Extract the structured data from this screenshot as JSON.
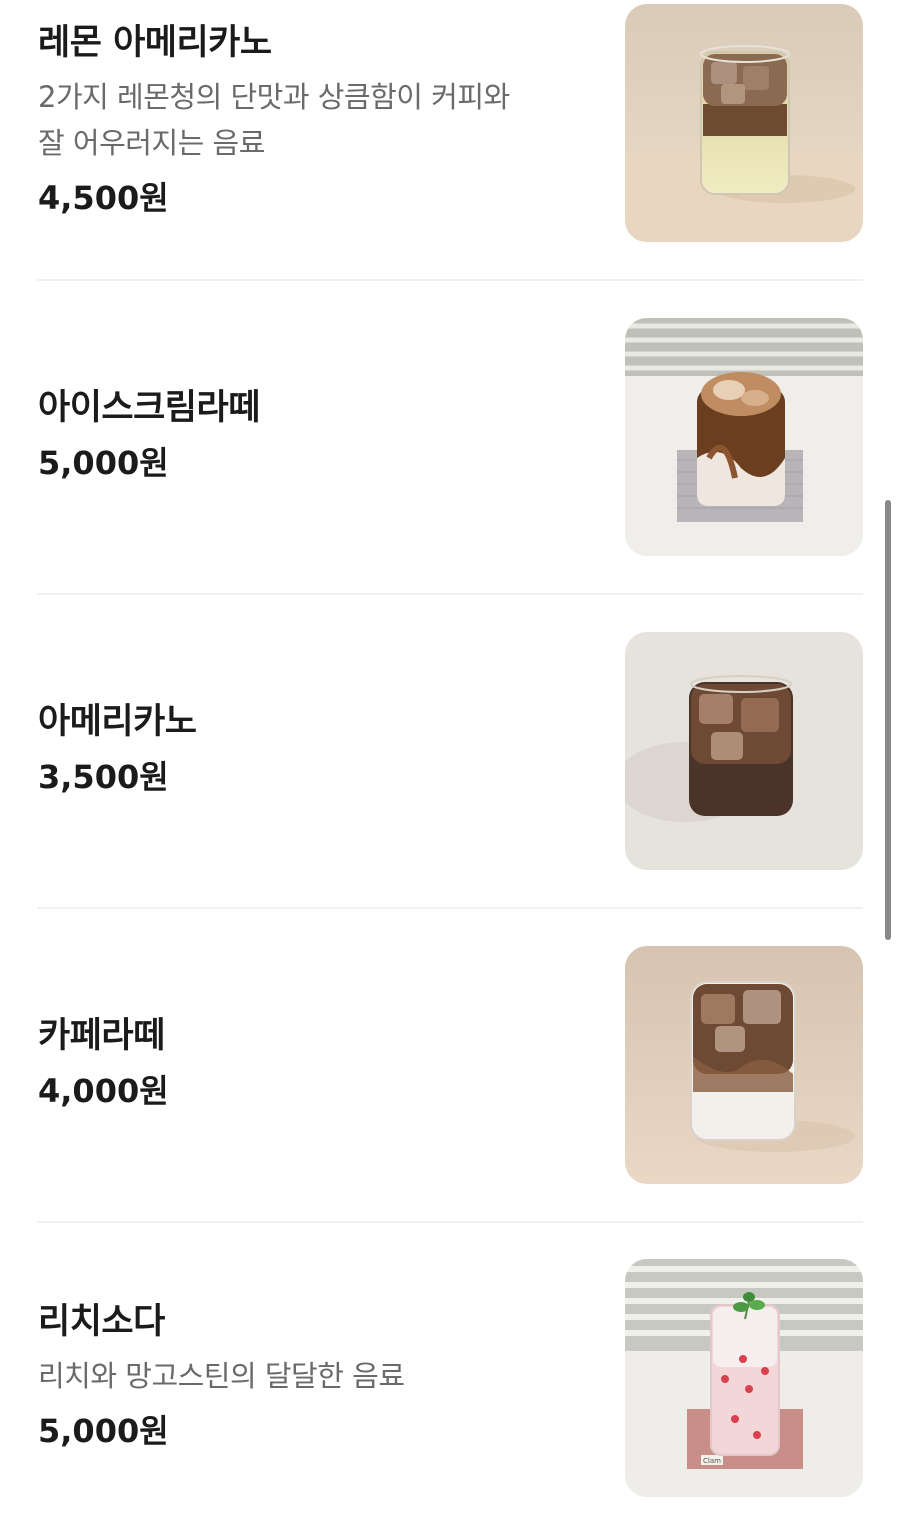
{
  "menu": {
    "items": [
      {
        "name": "레몬 아메리카노",
        "desc_line1": "2가지 레몬청의 단맛과 상큼함이 커피와",
        "desc_line2": "잘 어우러지는 음료",
        "price": "4,500원",
        "image_icon": "lemon-americano-photo"
      },
      {
        "name": "아이스크림라떼",
        "price": "5,000원",
        "image_icon": "ice-cream-latte-photo"
      },
      {
        "name": "아메리카노",
        "price": "3,500원",
        "image_icon": "americano-photo"
      },
      {
        "name": "카페라떼",
        "price": "4,000원",
        "image_icon": "cafe-latte-photo"
      },
      {
        "name": "리치소다",
        "desc_line1": "리치와 망고스틴의 달달한 음료",
        "price": "5,000원",
        "image_icon": "lychee-soda-photo",
        "coaster_text": "Clam"
      }
    ]
  },
  "colors": {
    "text_primary": "#1b1b1b",
    "text_secondary": "#6a6a6a",
    "divider": "#f1f1f1",
    "scrollbar": "#8a8a8a"
  }
}
